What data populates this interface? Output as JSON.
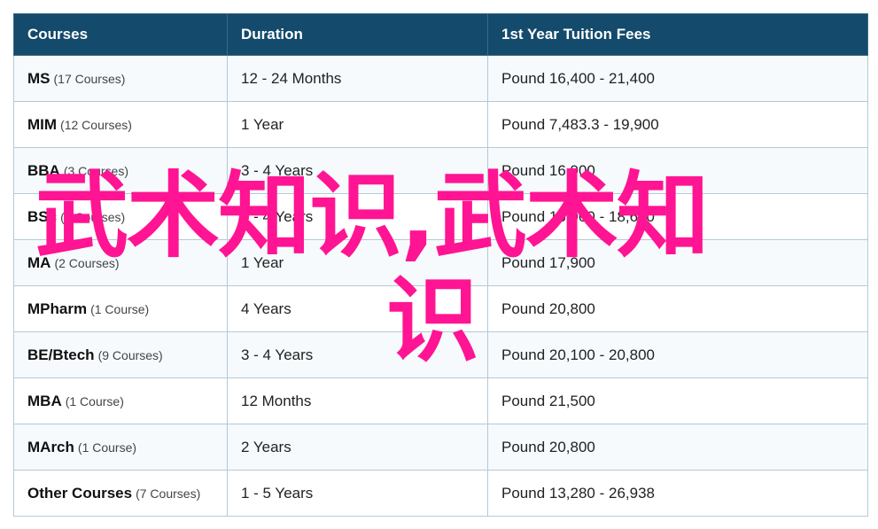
{
  "table": {
    "headers": [
      "Courses",
      "Duration",
      "1st Year Tuition Fees"
    ],
    "rows": [
      {
        "course": "MS",
        "count": "(17 Courses)",
        "duration": "12 - 24 Months",
        "fee": "Pound 16,400 - 21,400"
      },
      {
        "course": "MIM",
        "count": "(12 Courses)",
        "duration": "1 Year",
        "fee": "Pound 7,483.3 - 19,900"
      },
      {
        "course": "BBA",
        "count": "(3 Courses)",
        "duration": "3 - 4 Years",
        "fee": "Pound 16,900"
      },
      {
        "course": "BSc",
        "count": "(5 Courses)",
        "duration": "3 - 4 Years",
        "fee": "Pound 16,900 - 18,600"
      },
      {
        "course": "MA",
        "count": "(2 Courses)",
        "duration": "1 Year",
        "fee": "Pound 17,900"
      },
      {
        "course": "MPharm",
        "count": "(1 Course)",
        "duration": "4 Years",
        "fee": "Pound 20,800"
      },
      {
        "course": "BE/Btech",
        "count": "(9 Courses)",
        "duration": "3 - 4 Years",
        "fee": "Pound 20,100 - 20,800"
      },
      {
        "course": "MBA",
        "count": "(1 Course)",
        "duration": "12 Months",
        "fee": "Pound 21,500"
      },
      {
        "course": "MArch",
        "count": "(1 Course)",
        "duration": "2 Years",
        "fee": "Pound 20,800"
      },
      {
        "course": "Other Courses",
        "count": "(7 Courses)",
        "duration": "1 - 5 Years",
        "fee": "Pound 13,280 - 26,938"
      }
    ]
  },
  "overlay": {
    "line1": "武术知识,武术知",
    "line2": "识",
    "color": "#ff1493"
  }
}
